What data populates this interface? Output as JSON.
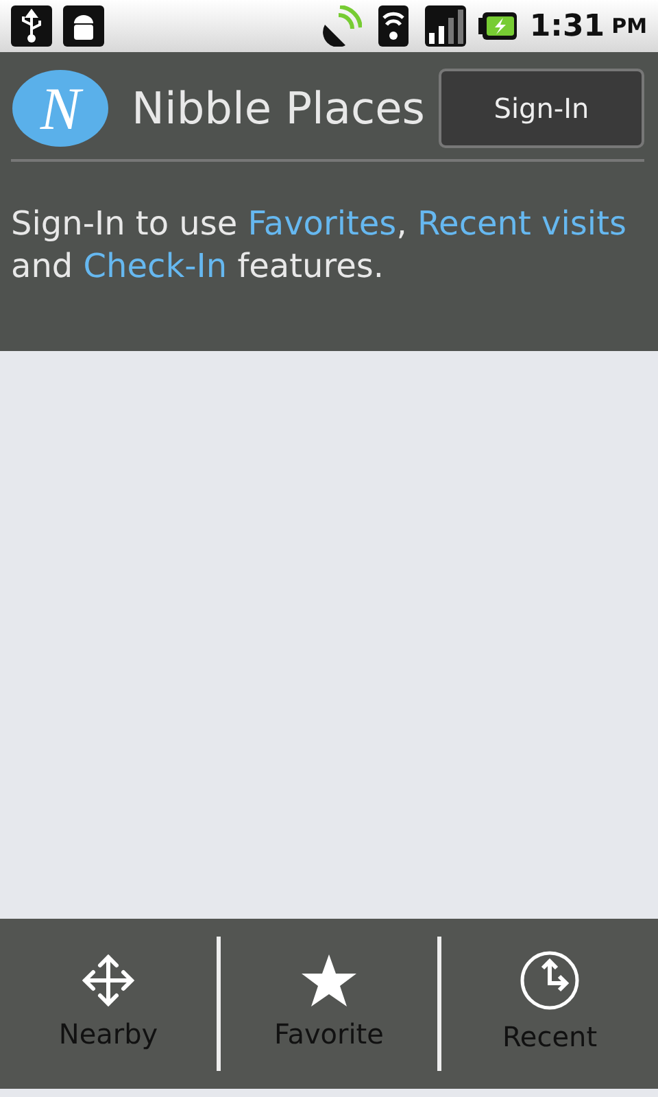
{
  "status_bar": {
    "time": "1:31",
    "ampm": "PM"
  },
  "header": {
    "title": "Nibble Places",
    "logo_letter": "N",
    "button": "Sign-In"
  },
  "message": [
    {
      "kind": "text",
      "text": "Sign-In to use "
    },
    {
      "kind": "link",
      "text": "Favorites"
    },
    {
      "kind": "text",
      "text": ", "
    },
    {
      "kind": "link",
      "text": "Recent visits"
    },
    {
      "kind": "text",
      "text": " and "
    },
    {
      "kind": "link",
      "text": "Check-In"
    },
    {
      "kind": "text",
      "text": " features."
    }
  ],
  "tabs": [
    {
      "kind": "nearby",
      "label": "Nearby"
    },
    {
      "kind": "favorite",
      "label": "Favorite"
    },
    {
      "kind": "recent",
      "label": "Recent"
    }
  ]
}
